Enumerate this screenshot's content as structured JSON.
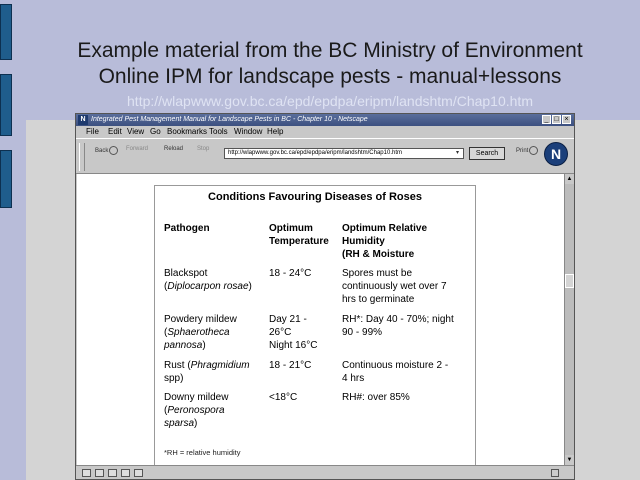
{
  "slide": {
    "title_line1": "Example material from the BC Ministry of Environment",
    "title_line2": "Online IPM for landscape pests - manual+lessons",
    "url": "http://wlapwww.gov.bc.ca/epd/epdpa/eripm/landshtm/Chap10.htm"
  },
  "browser": {
    "window_title": "Integrated Pest Management Manual for Landscape Pests in BC - Chapter 10 - Netscape",
    "logo_letter": "N",
    "menu": [
      "File",
      "Edit",
      "View",
      "Go",
      "Bookmarks",
      "Tools",
      "Window",
      "Help"
    ],
    "toolbar": {
      "back": "Back",
      "forward": "Forward",
      "reload": "Reload",
      "stop": "Stop",
      "search": "Search",
      "print": "Print"
    },
    "url_value": "http://wlapwww.gov.bc.ca/epd/epdpa/eripm/landshtm/Chap10.htm"
  },
  "table": {
    "title": "Conditions Favouring Diseases of Roses",
    "headers": {
      "pathogen": "Pathogen",
      "temp_line1": "Optimum",
      "temp_line2": "Temperature",
      "rh_line1": "Optimum Relative",
      "rh_line2": "Humidity",
      "rh_line3": "(RH & Moisture"
    },
    "rows": [
      {
        "name": "Blackspot",
        "latin": "Diplocarpon rosae",
        "temp": [
          "18 - 24°C"
        ],
        "rh": [
          "Spores must be",
          "continuously wet over 7",
          "hrs to germinate"
        ]
      },
      {
        "name": "Powdery mildew",
        "latin_line1": "Sphaerotheca",
        "latin_line2": "pannosa",
        "temp": [
          "Day 21 -",
          "26°C",
          "Night 16°C"
        ],
        "rh": [
          "RH*: Day 40 - 70%; night",
          "90 - 99%"
        ]
      },
      {
        "name": "Rust",
        "latin_line1": "Phragmidium",
        "latin_line2": "spp",
        "temp": [
          "18 - 21°C"
        ],
        "rh": [
          "Continuous moisture 2 -",
          "4 hrs"
        ]
      },
      {
        "name": "Downy mildew",
        "latin_line1": "Peronospora",
        "latin_line2": "sparsa",
        "temp": [
          "<18°C"
        ],
        "rh": [
          "RH#: over 85%"
        ]
      }
    ],
    "footnote": "*RH = relative humidity"
  }
}
